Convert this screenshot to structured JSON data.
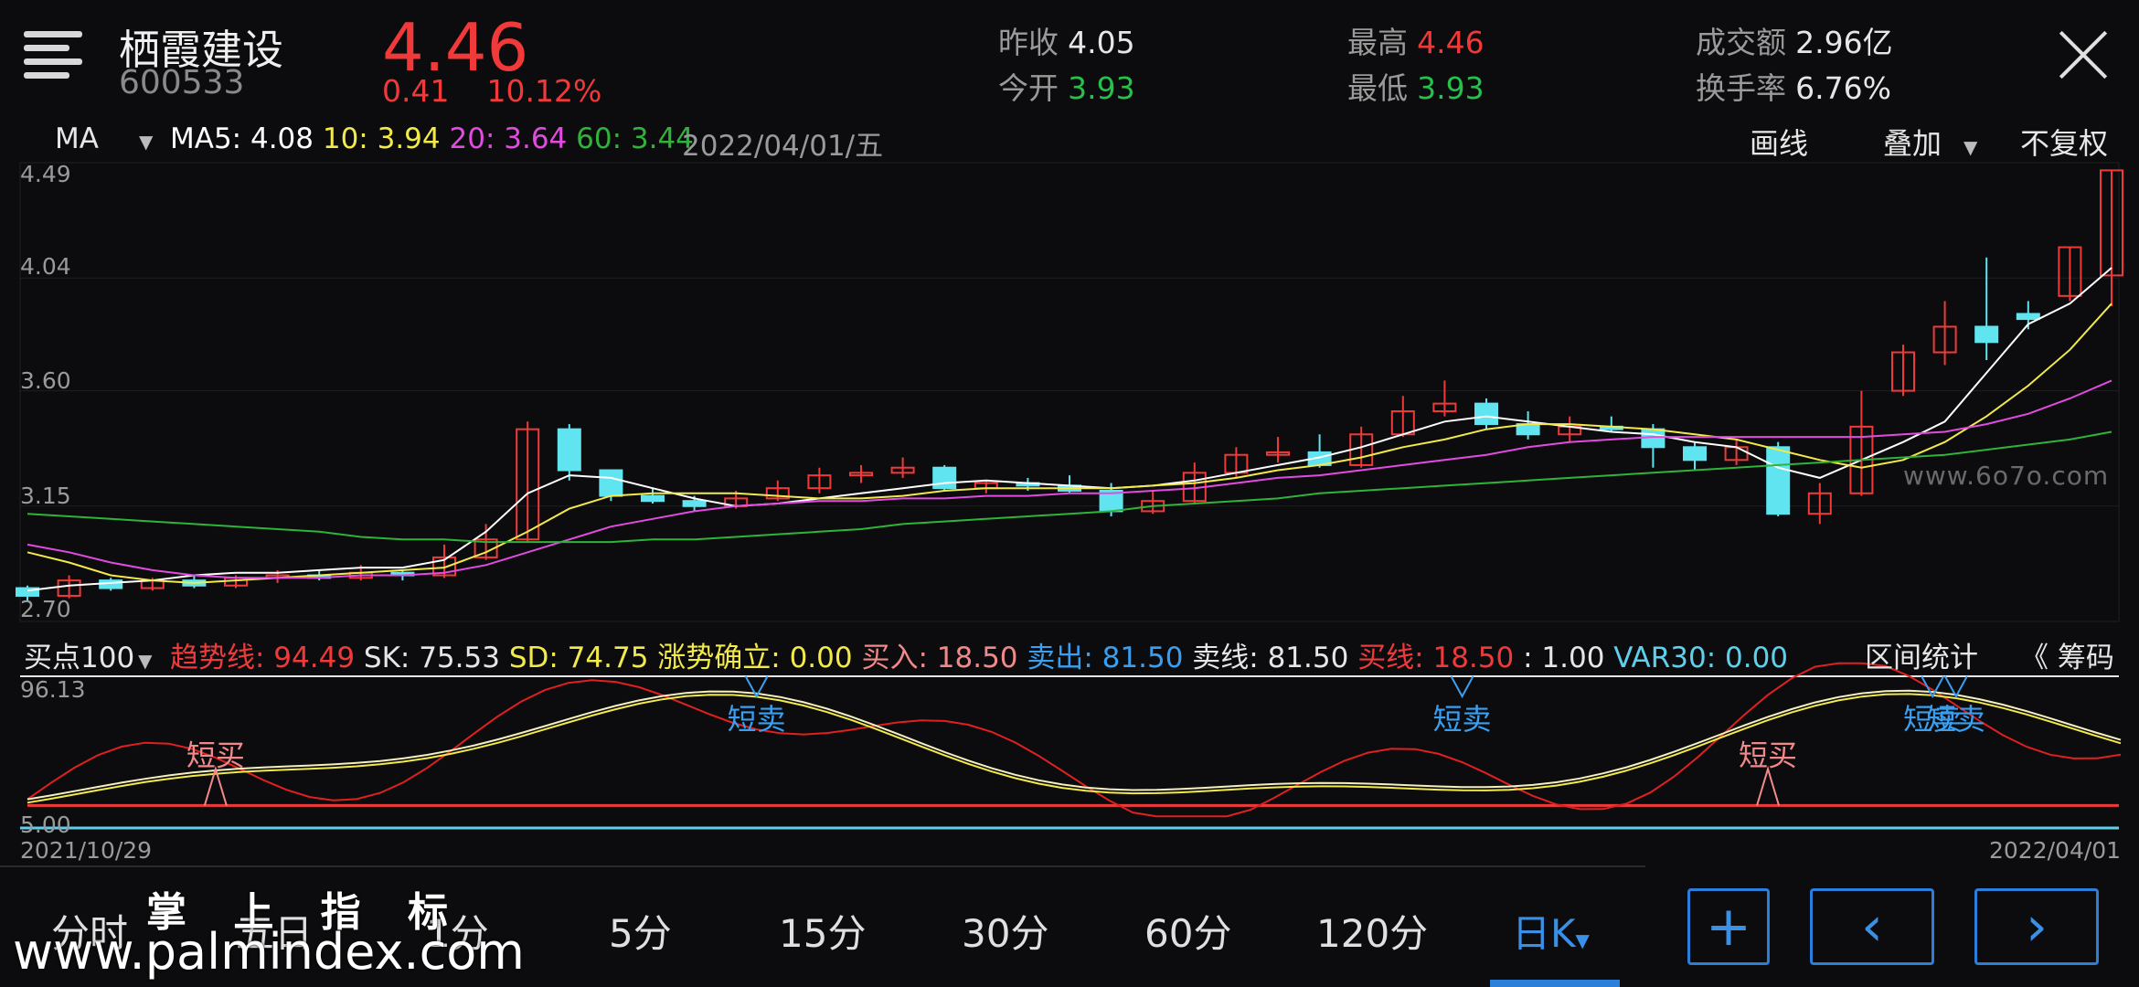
{
  "header": {
    "name": "栖霞建设",
    "code": "600533",
    "price": "4.46",
    "change": "0.41",
    "change_pct": "10.12%",
    "stats": [
      {
        "label": "昨收",
        "value": "4.05",
        "color": "#e6e6e6"
      },
      {
        "label": "今开",
        "value": "3.93",
        "color": "#27c04a"
      },
      {
        "label": "最高",
        "value": "4.46",
        "color": "#f03a3a"
      },
      {
        "label": "最低",
        "value": "3.93",
        "color": "#27c04a"
      },
      {
        "label": "成交额",
        "value": "2.96亿",
        "color": "#e6e6e6"
      },
      {
        "label": "换手率",
        "value": "6.76%",
        "color": "#e6e6e6"
      }
    ]
  },
  "ma_bar": {
    "selector": "MA",
    "ma5": "MA5: 4.08",
    "ma10": "10: 3.94",
    "ma20": "20: 3.64",
    "ma60": "60: 3.44",
    "date": "2022/04/01/五",
    "draw_label": "画线",
    "overlay_label": "叠加",
    "adjust_label": "不复权"
  },
  "chart_data": {
    "type": "candlestick",
    "price_axis_ticks": [
      "4.49",
      "4.04",
      "3.60",
      "3.15",
      "2.70"
    ],
    "ylim": [
      2.7,
      4.49
    ],
    "date_start": "2021/10/29",
    "date_end": "2022/04/01",
    "series": [
      {
        "name": "MA5",
        "color": "#ffffff",
        "values": [
          2.82,
          2.84,
          2.85,
          2.86,
          2.88,
          2.89,
          2.89,
          2.9,
          2.91,
          2.91,
          2.94,
          3.05,
          3.2,
          3.27,
          3.26,
          3.22,
          3.18,
          3.15,
          3.16,
          3.18,
          3.2,
          3.22,
          3.24,
          3.25,
          3.24,
          3.23,
          3.22,
          3.23,
          3.25,
          3.28,
          3.31,
          3.34,
          3.38,
          3.43,
          3.48,
          3.5,
          3.48,
          3.46,
          3.44,
          3.43,
          3.4,
          3.38,
          3.3,
          3.26,
          3.33,
          3.4,
          3.48,
          3.67,
          3.86,
          3.94,
          4.08
        ]
      },
      {
        "name": "MA10",
        "color": "#f2e94b",
        "values": [
          2.97,
          2.93,
          2.88,
          2.86,
          2.85,
          2.86,
          2.87,
          2.88,
          2.89,
          2.9,
          2.91,
          2.97,
          3.05,
          3.14,
          3.19,
          3.2,
          3.2,
          3.2,
          3.19,
          3.18,
          3.18,
          3.19,
          3.21,
          3.22,
          3.22,
          3.22,
          3.22,
          3.23,
          3.24,
          3.26,
          3.29,
          3.31,
          3.34,
          3.38,
          3.41,
          3.45,
          3.47,
          3.47,
          3.46,
          3.45,
          3.43,
          3.41,
          3.37,
          3.33,
          3.3,
          3.33,
          3.4,
          3.5,
          3.62,
          3.76,
          3.94
        ]
      },
      {
        "name": "MA20",
        "color": "#e24be0",
        "values": [
          3.0,
          2.97,
          2.93,
          2.9,
          2.88,
          2.87,
          2.87,
          2.87,
          2.88,
          2.88,
          2.89,
          2.92,
          2.97,
          3.02,
          3.07,
          3.1,
          3.13,
          3.15,
          3.16,
          3.17,
          3.17,
          3.18,
          3.18,
          3.19,
          3.19,
          3.2,
          3.2,
          3.21,
          3.22,
          3.24,
          3.26,
          3.27,
          3.29,
          3.31,
          3.33,
          3.35,
          3.38,
          3.4,
          3.41,
          3.42,
          3.42,
          3.42,
          3.42,
          3.42,
          3.42,
          3.43,
          3.44,
          3.47,
          3.51,
          3.57,
          3.64
        ]
      },
      {
        "name": "MA60",
        "color": "#2fb33a",
        "values": [
          3.12,
          3.11,
          3.1,
          3.09,
          3.08,
          3.07,
          3.06,
          3.05,
          3.03,
          3.02,
          3.02,
          3.01,
          3.01,
          3.01,
          3.01,
          3.02,
          3.02,
          3.03,
          3.04,
          3.05,
          3.06,
          3.08,
          3.09,
          3.1,
          3.11,
          3.12,
          3.13,
          3.15,
          3.16,
          3.17,
          3.18,
          3.2,
          3.21,
          3.22,
          3.23,
          3.24,
          3.25,
          3.26,
          3.27,
          3.28,
          3.29,
          3.3,
          3.31,
          3.32,
          3.33,
          3.34,
          3.35,
          3.37,
          3.39,
          3.41,
          3.44
        ]
      }
    ],
    "candles": [
      [
        2.83,
        2.8,
        2.84,
        2.78
      ],
      [
        2.8,
        2.86,
        2.88,
        2.79
      ],
      [
        2.86,
        2.83,
        2.87,
        2.82
      ],
      [
        2.83,
        2.86,
        2.87,
        2.82
      ],
      [
        2.86,
        2.84,
        2.88,
        2.83
      ],
      [
        2.84,
        2.87,
        2.88,
        2.83
      ],
      [
        2.87,
        2.88,
        2.9,
        2.85
      ],
      [
        2.88,
        2.87,
        2.9,
        2.86
      ],
      [
        2.87,
        2.89,
        2.92,
        2.86
      ],
      [
        2.89,
        2.88,
        2.9,
        2.86
      ],
      [
        2.88,
        2.95,
        3.0,
        2.87
      ],
      [
        2.95,
        3.02,
        3.08,
        2.94
      ],
      [
        3.02,
        3.45,
        3.48,
        3.01
      ],
      [
        3.45,
        3.29,
        3.47,
        3.25
      ],
      [
        3.29,
        3.19,
        3.29,
        3.17
      ],
      [
        3.19,
        3.17,
        3.22,
        3.16
      ],
      [
        3.17,
        3.15,
        3.19,
        3.13
      ],
      [
        3.15,
        3.18,
        3.21,
        3.14
      ],
      [
        3.18,
        3.22,
        3.25,
        3.17
      ],
      [
        3.22,
        3.27,
        3.3,
        3.2
      ],
      [
        3.27,
        3.28,
        3.31,
        3.24
      ],
      [
        3.28,
        3.3,
        3.34,
        3.26
      ],
      [
        3.3,
        3.22,
        3.31,
        3.21
      ],
      [
        3.22,
        3.24,
        3.25,
        3.2
      ],
      [
        3.24,
        3.23,
        3.26,
        3.21
      ],
      [
        3.23,
        3.21,
        3.27,
        3.2
      ],
      [
        3.21,
        3.13,
        3.24,
        3.11
      ],
      [
        3.13,
        3.17,
        3.21,
        3.12
      ],
      [
        3.17,
        3.28,
        3.32,
        3.16
      ],
      [
        3.28,
        3.35,
        3.38,
        3.26
      ],
      [
        3.35,
        3.36,
        3.42,
        3.32
      ],
      [
        3.36,
        3.31,
        3.43,
        3.3
      ],
      [
        3.31,
        3.43,
        3.46,
        3.3
      ],
      [
        3.43,
        3.52,
        3.58,
        3.42
      ],
      [
        3.52,
        3.55,
        3.64,
        3.5
      ],
      [
        3.55,
        3.47,
        3.57,
        3.45
      ],
      [
        3.47,
        3.43,
        3.52,
        3.41
      ],
      [
        3.43,
        3.46,
        3.5,
        3.4
      ],
      [
        3.46,
        3.45,
        3.5,
        3.44
      ],
      [
        3.45,
        3.38,
        3.47,
        3.3
      ],
      [
        3.38,
        3.33,
        3.4,
        3.29
      ],
      [
        3.33,
        3.38,
        3.41,
        3.31
      ],
      [
        3.38,
        3.12,
        3.4,
        3.11
      ],
      [
        3.12,
        3.2,
        3.24,
        3.08
      ],
      [
        3.2,
        3.46,
        3.6,
        3.19
      ],
      [
        3.6,
        3.75,
        3.78,
        3.58
      ],
      [
        3.75,
        3.85,
        3.95,
        3.7
      ],
      [
        3.85,
        3.79,
        4.12,
        3.72
      ],
      [
        3.9,
        3.88,
        3.95,
        3.84
      ],
      [
        3.97,
        4.16,
        4.16,
        3.95
      ],
      [
        4.05,
        4.46,
        4.46,
        3.93
      ]
    ]
  },
  "indicator": {
    "selector": "买点100",
    "items": [
      {
        "text": "趋势线: 94.49",
        "color": "#f03a3a"
      },
      {
        "text": "SK: 75.53",
        "color": "#e6e6e6"
      },
      {
        "text": "SD: 74.75",
        "color": "#f2e94b"
      },
      {
        "text": "涨势确立: 0.00",
        "color": "#f2e94b"
      },
      {
        "text": "买入: 18.50",
        "color": "#f08a8a"
      },
      {
        "text": "卖出: 81.50",
        "color": "#3a9ff0"
      },
      {
        "text": "卖线: 81.50",
        "color": "#e6e6e6"
      },
      {
        "text": "买线: 18.50",
        "color": "#f03a3a"
      },
      {
        "text": ": 1.00",
        "color": "#e6e6e6"
      },
      {
        "text": "VAR30: 0.00",
        "color": "#5fd0ec"
      }
    ],
    "range_stats": "区间统计",
    "chips": "《 筹码",
    "top_tick": "96.13",
    "bottom_tick": "5.00",
    "signals": [
      {
        "text": "短买",
        "type": "buy",
        "at": 8
      },
      {
        "text": "短卖",
        "type": "sell",
        "at": 31
      },
      {
        "text": "短卖",
        "type": "sell",
        "at": 61
      },
      {
        "text": "短买",
        "type": "buy",
        "at": 74
      },
      {
        "text": "短卖",
        "type": "sell",
        "at": 81
      },
      {
        "text": "短卖",
        "type": "sell",
        "at": 82
      }
    ]
  },
  "tabs": [
    "分时",
    "五日",
    "1分",
    "5分",
    "15分",
    "30分",
    "60分",
    "120分",
    "日K"
  ],
  "active_tab": "日K",
  "nav_buttons": {
    "add": "+",
    "prev": "‹",
    "next": "›"
  },
  "watermarks": {
    "mark1": "www.6o7o.com",
    "mark2": "掌 上 指 标",
    "mark3": "www.palmindex.com"
  }
}
